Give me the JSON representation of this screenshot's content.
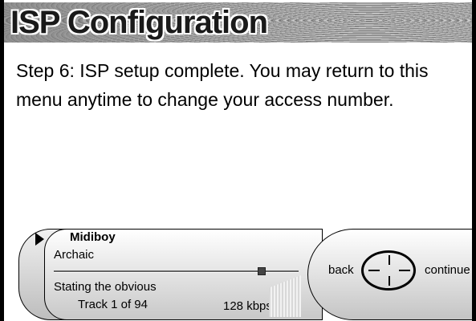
{
  "header": {
    "title": "ISP Configuration"
  },
  "main": {
    "message": "Step 6: ISP setup complete. You may return to this menu anytime to change your access number."
  },
  "player": {
    "artist": "Midiboy",
    "album": "Archaic",
    "song": "Stating the obvious",
    "track_info": "Track 1  of 94",
    "bitrate": "128 kbps",
    "progress": 0.86,
    "play_icon": "play-arrow-icon"
  },
  "nav": {
    "back_label": "back",
    "continue_label": "continue",
    "dpad_icon": "directional-pad-icon"
  }
}
